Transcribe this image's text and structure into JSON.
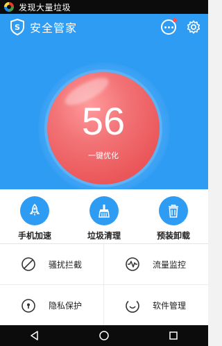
{
  "status_bar": {
    "notification_text": "发现大量垃圾",
    "icon": "app-logo-icon"
  },
  "header": {
    "title": "安全管家",
    "logo_icon": "shield-icon",
    "more_icon": "more-icon",
    "settings_icon": "gear-icon"
  },
  "score": {
    "value": "56",
    "action_label": "一键优化"
  },
  "features": [
    {
      "label": "手机加速",
      "icon": "rocket-icon"
    },
    {
      "label": "垃圾清理",
      "icon": "broom-icon"
    },
    {
      "label": "预装卸载",
      "icon": "trash-icon"
    }
  ],
  "tools": [
    {
      "label": "骚扰拦截",
      "icon": "block-icon"
    },
    {
      "label": "流量监控",
      "icon": "traffic-wave-icon"
    },
    {
      "label": "隐私保护",
      "icon": "lock-icon"
    },
    {
      "label": "软件管理",
      "icon": "smile-icon"
    }
  ],
  "nav": {
    "back_icon": "back-icon",
    "home_icon": "home-icon",
    "recent_icon": "recent-icon"
  },
  "colors": {
    "primary": "#2f9cf3",
    "score_circle": "#ea5659",
    "notification_badge": "#ff4c4c"
  }
}
